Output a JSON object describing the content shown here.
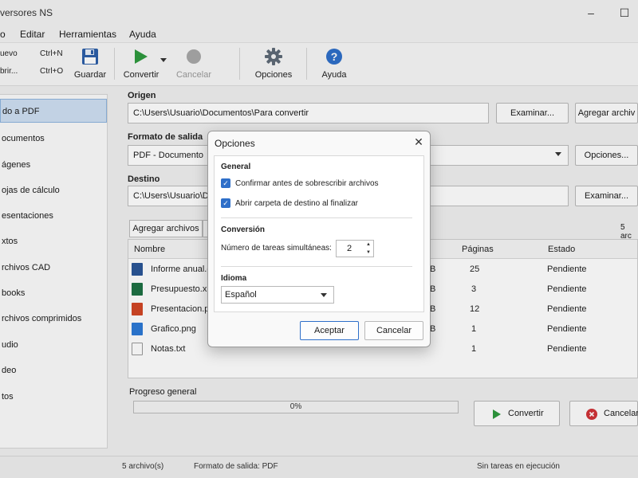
{
  "window": {
    "title": "versores NS",
    "minimize": "–",
    "maximize": "☐"
  },
  "menu": [
    "o",
    "Editar",
    "Herramientas",
    "Ayuda"
  ],
  "toolbar": {
    "shortcuts": [
      {
        "label": "uevo",
        "key": "Ctrl+N"
      },
      {
        "label": "brir...",
        "key": "Ctrl+O"
      }
    ],
    "save": "Guardar",
    "convert": "Convertir",
    "cancel": "Cancelar",
    "options": "Opciones",
    "help": "Ayuda"
  },
  "sidebar": {
    "items": [
      "do a PDF",
      "ocumentos",
      "ágenes",
      "ojas de cálculo",
      "esentaciones",
      "xtos",
      "rchivos CAD",
      "books",
      "rchivos comprimidos",
      "udio",
      "deo",
      "tos"
    ],
    "selected_index": 0
  },
  "origin": {
    "label": "Origen",
    "path": "C:\\Users\\Usuario\\Documentos\\Para convertir",
    "browse": "Examinar...",
    "add": "Agregar archiv"
  },
  "output_format": {
    "label": "Formato de salida",
    "value": "PDF - Documento",
    "options_button": "Opciones..."
  },
  "destination": {
    "label": "Destino",
    "path": "C:\\Users\\Usuario\\Documentos\\Co",
    "browse": "Examinar..."
  },
  "file_list": {
    "add_files": "Agregar archivos",
    "count_right": "5 arc",
    "columns": {
      "name": "Nombre",
      "pages": "Páginas",
      "status": "Estado"
    },
    "rows": [
      {
        "name": "Informe anual.d",
        "size_suffix": "B",
        "pages": "25",
        "status": "Pendiente",
        "icon": "word-icon",
        "color": "#2b5797"
      },
      {
        "name": "Presupuesto.xlsx",
        "size_suffix": "B",
        "pages": "3",
        "status": "Pendiente",
        "icon": "excel-icon",
        "color": "#1e7145"
      },
      {
        "name": "Presentacion.pp",
        "size_suffix": "B",
        "pages": "12",
        "status": "Pendiente",
        "icon": "powerpoint-icon",
        "color": "#d24726"
      },
      {
        "name": "Grafico.png",
        "size_suffix": "B",
        "pages": "1",
        "status": "Pendiente",
        "icon": "image-icon",
        "color": "#2d7ad6"
      },
      {
        "name": "Notas.txt",
        "size_suffix": "",
        "pages": "1",
        "status": "Pendiente",
        "icon": "text-file-icon",
        "color": "#9a9a9a"
      }
    ]
  },
  "progress": {
    "label": "Progreso general",
    "value": 0,
    "text": "0%"
  },
  "actions": {
    "convert": "Convertir",
    "cancel": "Cancelar"
  },
  "statusbar": {
    "count": "5 archivo(s)",
    "format": "Formato de salida:  PDF",
    "state": "Sin tareas en ejecución"
  },
  "dialog": {
    "title": "Opciones",
    "close": "✕",
    "general": {
      "heading": "General",
      "overwrite": "Confirmar antes de sobrescribir archivos",
      "open_folder": "Abrir carpeta de destino al finalizar"
    },
    "conversion": {
      "heading": "Conversión",
      "tasks_label": "Número de tareas simultáneas:",
      "tasks_value": "2"
    },
    "language": {
      "heading": "Idioma",
      "value": "Español"
    },
    "accept": "Aceptar",
    "cancel": "Cancelar"
  },
  "colors": {
    "accent": "#2e6fc9",
    "play_green": "#2e9a3e",
    "cancel_red": "#d13438",
    "save_blue": "#2d5fa8"
  }
}
